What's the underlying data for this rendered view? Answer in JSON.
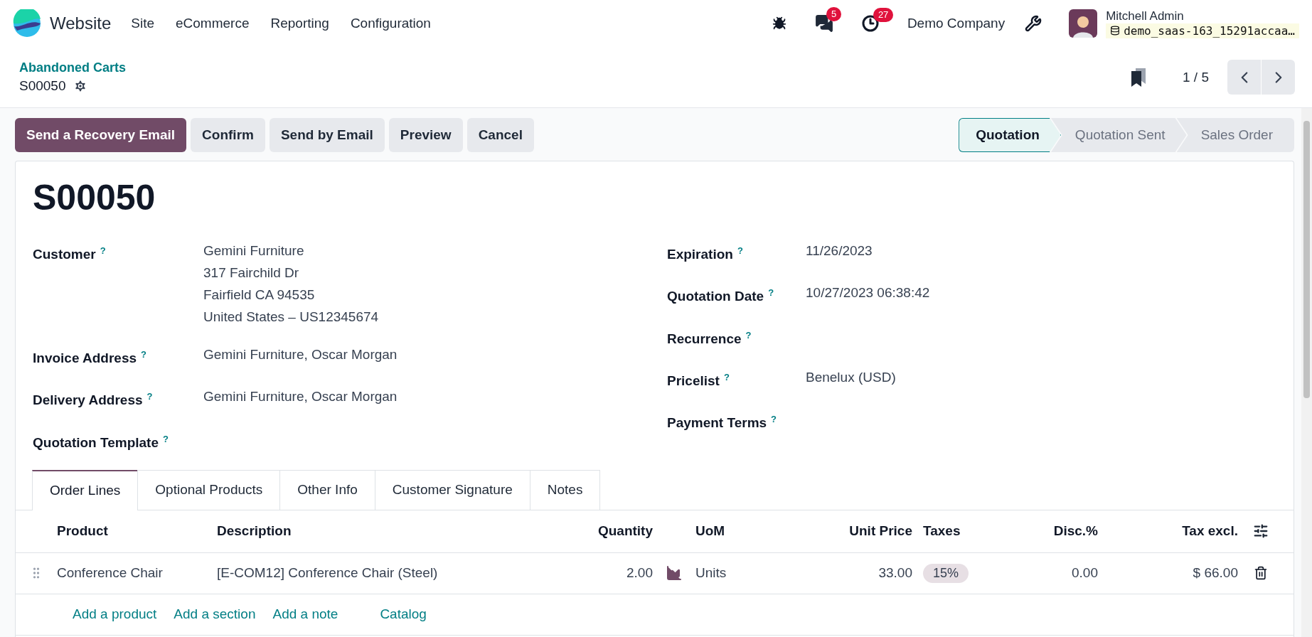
{
  "navbar": {
    "app_name": "Website",
    "menu": [
      "Site",
      "eCommerce",
      "Reporting",
      "Configuration"
    ],
    "messages_count": "5",
    "activities_count": "27",
    "company": "Demo Company",
    "user_name": "Mitchell Admin",
    "database": "demo_saas-163_15291accaa…"
  },
  "breadcrumb": {
    "parent": "Abandoned Carts",
    "current": "S00050"
  },
  "pager": "1 / 5",
  "action_buttons": [
    {
      "label": "Send a Recovery Email",
      "kind": "primary"
    },
    {
      "label": "Confirm",
      "kind": "secondary"
    },
    {
      "label": "Send by Email",
      "kind": "secondary"
    },
    {
      "label": "Preview",
      "kind": "secondary"
    },
    {
      "label": "Cancel",
      "kind": "secondary"
    }
  ],
  "status_steps": [
    {
      "label": "Quotation",
      "selected": true
    },
    {
      "label": "Quotation Sent",
      "selected": false
    },
    {
      "label": "Sales Order",
      "selected": false
    }
  ],
  "title": "S00050",
  "left_fields": [
    {
      "label": "Customer",
      "help": "?",
      "lines": [
        "Gemini Furniture",
        "317 Fairchild Dr",
        "Fairfield CA 94535",
        "United States – US12345674"
      ]
    },
    {
      "label": "Invoice Address",
      "help": "?",
      "lines": [
        "Gemini Furniture, Oscar Morgan"
      ]
    },
    {
      "label": "Delivery Address",
      "help": "?",
      "lines": [
        "Gemini Furniture, Oscar Morgan"
      ]
    },
    {
      "label": "Quotation Template",
      "help": "?"
    }
  ],
  "right_fields": [
    {
      "label": "Expiration",
      "help": "?",
      "lines": [
        "11/26/2023"
      ]
    },
    {
      "label": "Quotation Date",
      "help": "?",
      "lines": [
        "10/27/2023 06:38:42"
      ]
    },
    {
      "label": "Recurrence",
      "help": "?"
    },
    {
      "label": "Pricelist",
      "help": "?",
      "lines": [
        "Benelux (USD)"
      ]
    },
    {
      "label": "Payment Terms",
      "help": "?"
    }
  ],
  "tabs": [
    {
      "label": "Order Lines",
      "selected": true
    },
    {
      "label": "Optional Products",
      "selected": false
    },
    {
      "label": "Other Info",
      "selected": false
    },
    {
      "label": "Customer Signature",
      "selected": false
    },
    {
      "label": "Notes",
      "selected": false
    }
  ],
  "table": {
    "columns": [
      "Product",
      "Description",
      "Quantity",
      "UoM",
      "Unit Price",
      "Taxes",
      "Disc.%",
      "Tax excl."
    ],
    "rows": [
      {
        "product": "Conference Chair",
        "description": "[E-COM12] Conference Chair (Steel)",
        "quantity": "2.00",
        "uom": "Units",
        "unit_price": "33.00",
        "taxes": [
          "15%"
        ],
        "discount": "0.00",
        "subtotal": "$ 66.00"
      }
    ],
    "add_links": [
      "Add a product",
      "Add a section",
      "Add a note",
      "Catalog"
    ]
  }
}
